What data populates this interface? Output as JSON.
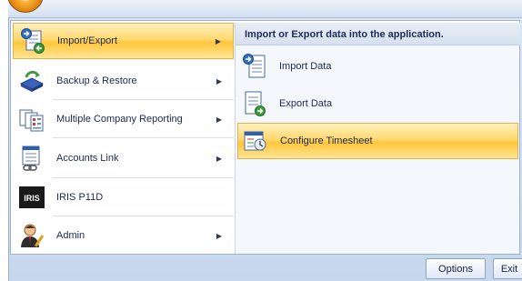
{
  "menu": {
    "left_items": [
      {
        "label": "Import/Export",
        "icon": "import-export-icon",
        "has_submenu": true,
        "active": true
      },
      {
        "label": "Backup & Restore",
        "icon": "backup-restore-icon",
        "has_submenu": true,
        "active": false
      },
      {
        "label": "Multiple Company Reporting",
        "icon": "multiple-company-icon",
        "has_submenu": true,
        "active": false
      },
      {
        "label": "Accounts Link",
        "icon": "accounts-link-icon",
        "has_submenu": true,
        "active": false
      },
      {
        "label": "IRIS P11D",
        "icon": "iris-logo-icon",
        "has_submenu": false,
        "active": false
      },
      {
        "label": "Admin",
        "icon": "admin-user-icon",
        "has_submenu": true,
        "active": false
      }
    ],
    "iris_logo_text": "IRIS",
    "submenu": {
      "header": "Import or Export data into the application.",
      "items": [
        {
          "label": "Import Data",
          "icon": "import-data-icon",
          "active": false
        },
        {
          "label": "Export Data",
          "icon": "export-data-icon",
          "active": false
        },
        {
          "label": "Configure Timesheet",
          "icon": "configure-timesheet-icon",
          "active": true
        }
      ]
    }
  },
  "footer": {
    "options_label": "Options",
    "exit_label": "Exit"
  },
  "colors": {
    "highlight": "#ffc63a",
    "frame": "#c6d6ec",
    "text": "#1b2a52"
  }
}
